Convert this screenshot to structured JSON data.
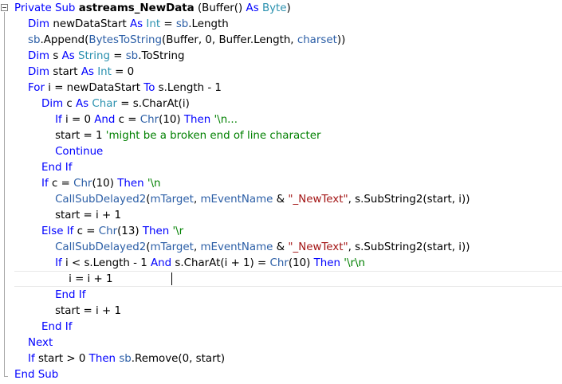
{
  "editor": {
    "lines": [
      [
        {
          "t": "Private Sub ",
          "c": "kw"
        },
        {
          "t": "astreams_NewData",
          "c": "fn"
        },
        {
          "t": " (Buffer() ",
          "c": ""
        },
        {
          "t": "As ",
          "c": "kw"
        },
        {
          "t": "Byte",
          "c": "ty"
        },
        {
          "t": ")",
          "c": ""
        }
      ],
      [
        {
          "t": "    Dim ",
          "c": "kw"
        },
        {
          "t": "newDataStart ",
          "c": ""
        },
        {
          "t": "As ",
          "c": "kw"
        },
        {
          "t": "Int",
          "c": "ty"
        },
        {
          "t": " = ",
          "c": ""
        },
        {
          "t": "sb",
          "c": "va"
        },
        {
          "t": ".Length",
          "c": ""
        }
      ],
      [
        {
          "t": "    sb",
          "c": "va"
        },
        {
          "t": ".Append(",
          "c": ""
        },
        {
          "t": "BytesToString",
          "c": "va"
        },
        {
          "t": "(Buffer, 0, Buffer.Length, ",
          "c": ""
        },
        {
          "t": "charset",
          "c": "va"
        },
        {
          "t": "))",
          "c": ""
        }
      ],
      [
        {
          "t": "    Dim ",
          "c": "kw"
        },
        {
          "t": "s ",
          "c": ""
        },
        {
          "t": "As ",
          "c": "kw"
        },
        {
          "t": "String",
          "c": "ty"
        },
        {
          "t": " = ",
          "c": ""
        },
        {
          "t": "sb",
          "c": "va"
        },
        {
          "t": ".ToString",
          "c": ""
        }
      ],
      [
        {
          "t": "    Dim ",
          "c": "kw"
        },
        {
          "t": "start ",
          "c": ""
        },
        {
          "t": "As ",
          "c": "kw"
        },
        {
          "t": "Int",
          "c": "ty"
        },
        {
          "t": " = 0",
          "c": ""
        }
      ],
      [
        {
          "t": "    For ",
          "c": "kw"
        },
        {
          "t": "i = newDataStart ",
          "c": ""
        },
        {
          "t": "To ",
          "c": "kw"
        },
        {
          "t": "s.Length - 1",
          "c": ""
        }
      ],
      [
        {
          "t": "        Dim ",
          "c": "kw"
        },
        {
          "t": "c ",
          "c": ""
        },
        {
          "t": "As ",
          "c": "kw"
        },
        {
          "t": "Char",
          "c": "ty"
        },
        {
          "t": " = s.CharAt(i)",
          "c": ""
        }
      ],
      [
        {
          "t": "            If ",
          "c": "kw"
        },
        {
          "t": "i = 0 ",
          "c": ""
        },
        {
          "t": "And ",
          "c": "kw"
        },
        {
          "t": "c = ",
          "c": ""
        },
        {
          "t": "Chr",
          "c": "va"
        },
        {
          "t": "(10) ",
          "c": ""
        },
        {
          "t": "Then ",
          "c": "kw"
        },
        {
          "t": "'\\n...",
          "c": "cm"
        }
      ],
      [
        {
          "t": "            start = 1 ",
          "c": ""
        },
        {
          "t": "'might be a broken end of line character",
          "c": "cm"
        }
      ],
      [
        {
          "t": "            Continue",
          "c": "kw"
        }
      ],
      [
        {
          "t": "        End If",
          "c": "kw"
        }
      ],
      [
        {
          "t": "        If ",
          "c": "kw"
        },
        {
          "t": "c = ",
          "c": ""
        },
        {
          "t": "Chr",
          "c": "va"
        },
        {
          "t": "(10) ",
          "c": ""
        },
        {
          "t": "Then ",
          "c": "kw"
        },
        {
          "t": "'\\n",
          "c": "cm"
        }
      ],
      [
        {
          "t": "            CallSubDelayed2",
          "c": "va"
        },
        {
          "t": "(",
          "c": ""
        },
        {
          "t": "mTarget",
          "c": "va"
        },
        {
          "t": ", ",
          "c": ""
        },
        {
          "t": "mEventName",
          "c": "va"
        },
        {
          "t": " & ",
          "c": ""
        },
        {
          "t": "\"_NewText\"",
          "c": "st"
        },
        {
          "t": ", s.SubString2(start, i))",
          "c": ""
        }
      ],
      [
        {
          "t": "            start = i + 1",
          "c": ""
        }
      ],
      [
        {
          "t": "        Else If ",
          "c": "kw"
        },
        {
          "t": "c = ",
          "c": ""
        },
        {
          "t": "Chr",
          "c": "va"
        },
        {
          "t": "(13) ",
          "c": ""
        },
        {
          "t": "Then ",
          "c": "kw"
        },
        {
          "t": "'\\r",
          "c": "cm"
        }
      ],
      [
        {
          "t": "            CallSubDelayed2",
          "c": "va"
        },
        {
          "t": "(",
          "c": ""
        },
        {
          "t": "mTarget",
          "c": "va"
        },
        {
          "t": ", ",
          "c": ""
        },
        {
          "t": "mEventName",
          "c": "va"
        },
        {
          "t": " & ",
          "c": ""
        },
        {
          "t": "\"_NewText\"",
          "c": "st"
        },
        {
          "t": ", s.SubString2(start, i))",
          "c": ""
        }
      ],
      [
        {
          "t": "            If ",
          "c": "kw"
        },
        {
          "t": "i < s.Length - 1 ",
          "c": ""
        },
        {
          "t": "And ",
          "c": "kw"
        },
        {
          "t": "s.CharAt(i + 1) = ",
          "c": ""
        },
        {
          "t": "Chr",
          "c": "va"
        },
        {
          "t": "(10) ",
          "c": ""
        },
        {
          "t": "Then ",
          "c": "kw"
        },
        {
          "t": "'\\r\\n",
          "c": "cm"
        }
      ],
      [
        {
          "t": "                i = i + 1",
          "c": ""
        }
      ],
      [
        {
          "t": "            End If",
          "c": "kw"
        }
      ],
      [
        {
          "t": "            start = i + 1",
          "c": ""
        }
      ],
      [
        {
          "t": "        End If",
          "c": "kw"
        }
      ],
      [
        {
          "t": "    Next",
          "c": "kw"
        }
      ],
      [
        {
          "t": "    If ",
          "c": "kw"
        },
        {
          "t": "start > 0 ",
          "c": ""
        },
        {
          "t": "Then ",
          "c": "kw"
        },
        {
          "t": "sb",
          "c": "va"
        },
        {
          "t": ".Remove(0, start)",
          "c": ""
        }
      ],
      [
        {
          "t": "End Sub",
          "c": "kw"
        }
      ]
    ]
  }
}
